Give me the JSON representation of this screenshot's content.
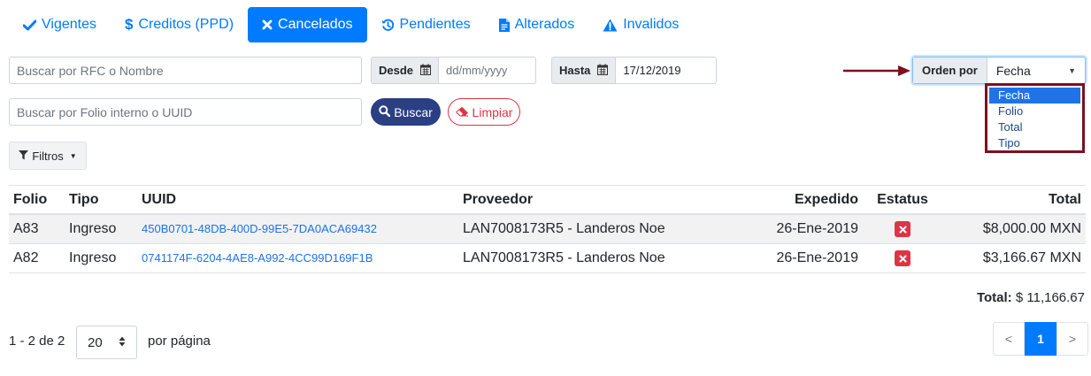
{
  "tabs": [
    {
      "label": "Vigentes",
      "icon": "check-icon",
      "active": false
    },
    {
      "label": "Creditos (PPD)",
      "icon": "dollar-icon",
      "active": false
    },
    {
      "label": "Cancelados",
      "icon": "times-icon",
      "active": true
    },
    {
      "label": "Pendientes",
      "icon": "history-icon",
      "active": false
    },
    {
      "label": "Alterados",
      "icon": "file-icon",
      "active": false
    },
    {
      "label": "Invalidos",
      "icon": "warning-icon",
      "active": false
    }
  ],
  "search": {
    "rfc_placeholder": "Buscar por RFC o Nombre",
    "folio_placeholder": "Buscar por Folio interno o UUID",
    "buscar_label": "Buscar",
    "limpiar_label": "Limpiar",
    "filtros_label": "Filtros"
  },
  "dates": {
    "desde_label": "Desde",
    "desde_placeholder": "dd/mm/yyyy",
    "hasta_label": "Hasta",
    "hasta_value": "17/12/2019"
  },
  "orden": {
    "label": "Orden por",
    "value": "Fecha",
    "options": [
      "Fecha",
      "Folio",
      "Total",
      "Tipo"
    ],
    "selected": "Fecha"
  },
  "table": {
    "headers": {
      "folio": "Folio",
      "tipo": "Tipo",
      "uuid": "UUID",
      "proveedor": "Proveedor",
      "expedido": "Expedido",
      "estatus": "Estatus",
      "total": "Total"
    },
    "rows": [
      {
        "folio": "A83",
        "tipo": "Ingreso",
        "uuid": "450B0701-48DB-400D-99E5-7DA0ACA69432",
        "proveedor": "LAN7008173R5 - Landeros Noe",
        "expedido": "26-Ene-2019",
        "total": "$8,000.00 MXN"
      },
      {
        "folio": "A82",
        "tipo": "Ingreso",
        "uuid": "0741174F-6204-4AE8-A992-4CC99D169F1B",
        "proveedor": "LAN7008173R5 - Landeros Noe",
        "expedido": "26-Ene-2019",
        "total": "$3,166.67 MXN"
      }
    ]
  },
  "summary": {
    "total_label": "Total:",
    "total_value": "$ 11,166.67"
  },
  "pagination": {
    "info": "1 - 2 de 2",
    "per_page": "20",
    "per_page_label": "por página",
    "prev": "<",
    "current": "1",
    "next": ">"
  },
  "colors": {
    "accent": "#007bff",
    "buscar": "#2b3f84",
    "danger": "#dc3545",
    "annotation": "#7f0f1e"
  }
}
